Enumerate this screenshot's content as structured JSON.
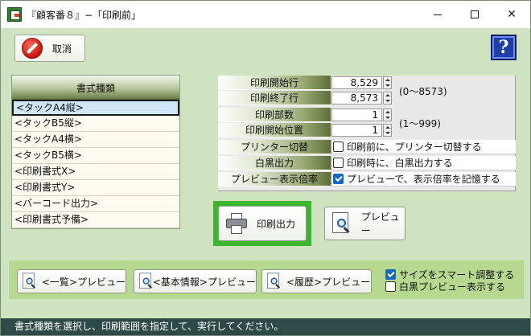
{
  "window": {
    "title": "『顧客番８』−「印刷前」",
    "close_glyph": "✕"
  },
  "toolbar": {
    "cancel_label": "取消",
    "help_label": "?"
  },
  "form_list": {
    "header": "書式種類",
    "items": [
      "<タックA4縦>",
      "<タックB5縦>",
      "<タックA4横>",
      "<タックB5横>",
      "<印刷書式X>",
      "<印刷書式Y>",
      "<バーコード出力>",
      "<印刷書式予備>"
    ],
    "selected_index": 0
  },
  "settings": {
    "print_start_label": "印刷開始行",
    "print_start_value": "8,529",
    "print_end_label": "印刷終了行",
    "print_end_value": "8,573",
    "row_range_note": "(0〜8573)",
    "copies_label": "印刷部数",
    "copies_value": "1",
    "start_position_label": "印刷開始位置",
    "start_position_value": "1",
    "copies_range_note": "(1〜999)",
    "printer_switch_label": "プリンター切替",
    "printer_switch_option": "印刷前に、プリンター切替する",
    "printer_switch_checked": false,
    "bw_output_label": "白黒出力",
    "bw_output_option": "印刷時に、白黒出力する",
    "bw_output_checked": false,
    "preview_zoom_label": "プレビュー表示倍率",
    "preview_zoom_option": "プレビューで、表示倍率を記憶する",
    "preview_zoom_checked": true
  },
  "actions": {
    "print_label": "印刷出力",
    "preview_label": "プレビュー"
  },
  "bottom": {
    "list_preview_label": "<一覧>プレビュー",
    "basic_preview_label": "<基本情報>プレビュー",
    "history_preview_label": "<履歴>プレビュー",
    "smart_size_label": "サイズをスマート調整する",
    "smart_size_checked": true,
    "bw_preview_label": "白黒プレビュー表示する",
    "bw_preview_checked": false
  },
  "status": {
    "message": "書式種類を選択し、印刷範囲を指定して、実行してください。"
  },
  "colors": {
    "window_bg": "#cfe3c0",
    "print_highlight": "#3cb52f",
    "bottom_panel": "#b6d98f",
    "status_bar": "#2e4a48",
    "help_button": "#1f3fa8"
  }
}
